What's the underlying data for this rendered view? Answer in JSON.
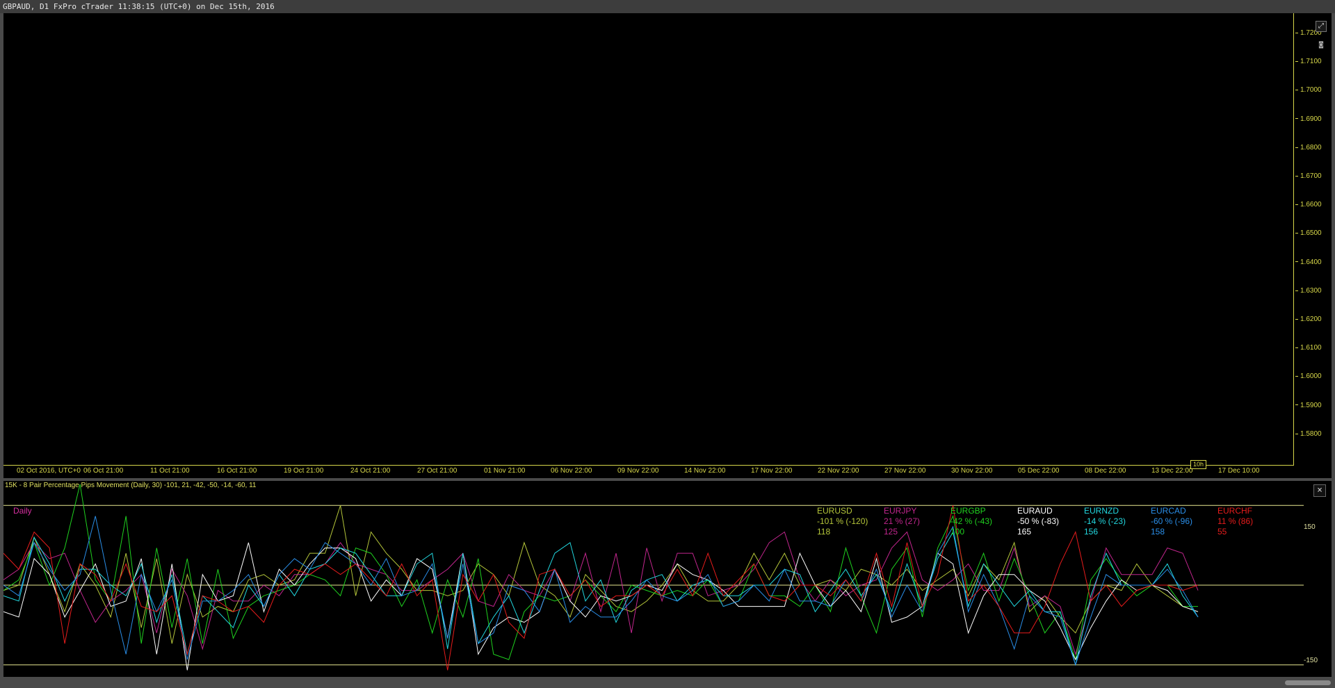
{
  "window": {
    "title": "GBPAUD, D1 FxPro cTrader 11:38:15 (UTC+0) on Dec 15th, 2016"
  },
  "main_chart": {
    "price_ticks": [
      "1.7200",
      "1.7100",
      "1.7000",
      "1.6900",
      "1.6800",
      "1.6700",
      "1.6600",
      "1.6500",
      "1.6400",
      "1.6300",
      "1.6200",
      "1.6100",
      "1.6000",
      "1.5900",
      "1.5800"
    ],
    "time_ticks": [
      "02 Oct 2016, UTC+0",
      "06 Oct 21:00",
      "11 Oct 21:00",
      "16 Oct 21:00",
      "19 Oct 21:00",
      "24 Oct 21:00",
      "27 Oct 21:00",
      "01 Nov 21:00",
      "06 Nov 22:00",
      "09 Nov 22:00",
      "14 Nov 22:00",
      "17 Nov 22:00",
      "22 Nov 22:00",
      "27 Nov 22:00",
      "30 Nov 22:00",
      "05 Dec 22:00",
      "08 Dec 22:00",
      "13 Dec 22:00",
      "17 Dec 10:00"
    ],
    "crosshair_label": "10h",
    "axis_color": "#d8d84a",
    "icons": [
      "expand-icon",
      "camera-icon"
    ]
  },
  "indicator": {
    "title": "15K - 8 Pair Percentage Pips Movement (Daily, 30) -101, 21, -42, -50, -14, -60, 11",
    "period_label": "Daily",
    "close_label": "×",
    "axis_labels": {
      "upper": "150",
      "lower": "-150"
    },
    "legend": [
      {
        "pair": "EURUSD",
        "pct": "-101 % (-120)",
        "value": "118",
        "color": "#b5c63a"
      },
      {
        "pair": "EURJPY",
        "pct": "21 % (27)",
        "value": "125",
        "color": "#c2268e"
      },
      {
        "pair": "EURGBP",
        "pct": "-42 % (-43)",
        "value": "100",
        "color": "#1fd21f"
      },
      {
        "pair": "EURAUD",
        "pct": "-50 % (-83)",
        "value": "165",
        "color": "#ffffff"
      },
      {
        "pair": "EURNZD",
        "pct": "-14 % (-23)",
        "value": "156",
        "color": "#22d8e0"
      },
      {
        "pair": "EURCAD",
        "pct": "-60 % (-96)",
        "value": "158",
        "color": "#2a8ee8"
      },
      {
        "pair": "EURCHF",
        "pct": "11 % (86)",
        "value": "55",
        "color": "#e81c1c"
      }
    ],
    "chart_data": {
      "type": "line",
      "ylim": [
        -170,
        170
      ],
      "hlines": [
        150,
        0,
        -150
      ],
      "series": [
        {
          "name": "EURUSD",
          "color": "#b5c63a",
          "values": [
            -10,
            0,
            90,
            20,
            -50,
            40,
            0,
            -60,
            60,
            -80,
            50,
            -110,
            20,
            -60,
            -40,
            -50,
            10,
            20,
            0,
            10,
            60,
            60,
            150,
            -20,
            100,
            60,
            30,
            -10,
            -10,
            -20,
            -10,
            40,
            20,
            -20,
            80,
            0,
            -20,
            -60,
            20,
            -10,
            -40,
            -50,
            -30,
            0,
            40,
            -10,
            -30,
            -30,
            0,
            60,
            10,
            60,
            0,
            0,
            10,
            -10,
            30,
            20,
            0,
            30,
            -10,
            10,
            30,
            -20,
            40,
            10,
            80,
            -50,
            -20,
            -60,
            -90,
            -30,
            0,
            -10,
            40,
            0,
            -20,
            -40,
            -50
          ]
        },
        {
          "name": "EURJPY",
          "color": "#c2268e",
          "values": [
            10,
            30,
            80,
            50,
            60,
            -10,
            -70,
            -30,
            -10,
            20,
            -90,
            30,
            -20,
            -120,
            -10,
            -30,
            -30,
            0,
            -20,
            20,
            20,
            40,
            80,
            40,
            30,
            20,
            -10,
            -10,
            10,
            30,
            60,
            -30,
            -40,
            20,
            -10,
            -20,
            30,
            -30,
            60,
            -50,
            60,
            -90,
            70,
            -30,
            60,
            60,
            -20,
            -10,
            0,
            30,
            80,
            100,
            10,
            -30,
            10,
            -20,
            0,
            10,
            70,
            100,
            10,
            -10,
            10,
            40,
            -10,
            -10,
            70,
            -40,
            -20,
            -40,
            -130,
            -30,
            70,
            20,
            20,
            20,
            70,
            60,
            -10
          ]
        },
        {
          "name": "EURGBP",
          "color": "#1fd21f",
          "values": [
            -10,
            10,
            80,
            0,
            70,
            190,
            10,
            -30,
            130,
            -110,
            70,
            -80,
            50,
            -110,
            30,
            -100,
            -40,
            -20,
            -10,
            0,
            20,
            10,
            -20,
            70,
            60,
            20,
            -40,
            10,
            -90,
            10,
            -60,
            50,
            -130,
            -140,
            -50,
            -20,
            -30,
            -20,
            10,
            -20,
            -50,
            0,
            -10,
            -20,
            -10,
            -20,
            10,
            -40,
            -30,
            40,
            -20,
            -20,
            -40,
            0,
            -50,
            70,
            -20,
            -90,
            30,
            70,
            -60,
            70,
            130,
            -10,
            60,
            -30,
            50,
            -20,
            -90,
            -50,
            -140,
            10,
            50,
            10,
            -20,
            0,
            0,
            -40,
            -40
          ]
        },
        {
          "name": "EURAUD",
          "color": "#ffffff",
          "values": [
            -50,
            -60,
            50,
            20,
            -60,
            -10,
            40,
            -40,
            -30,
            50,
            -130,
            40,
            -160,
            20,
            -30,
            -20,
            80,
            -50,
            30,
            0,
            40,
            70,
            70,
            50,
            -30,
            10,
            -20,
            50,
            30,
            -100,
            60,
            -130,
            -80,
            -60,
            -70,
            -50,
            30,
            -30,
            -60,
            -20,
            -30,
            -20,
            0,
            -10,
            40,
            20,
            10,
            -10,
            -40,
            -40,
            -40,
            -40,
            60,
            0,
            -40,
            -10,
            -50,
            50,
            -70,
            -60,
            -40,
            60,
            40,
            -90,
            -20,
            20,
            20,
            -10,
            -30,
            -80,
            -140,
            -80,
            -30,
            10,
            -10,
            0,
            -10,
            -40,
            -50
          ]
        },
        {
          "name": "EURNZD",
          "color": "#22d8e0",
          "values": [
            -20,
            -30,
            90,
            40,
            -30,
            30,
            30,
            0,
            -20,
            40,
            -70,
            20,
            -130,
            -20,
            -50,
            -80,
            0,
            -40,
            20,
            -20,
            30,
            40,
            70,
            60,
            20,
            -20,
            -20,
            40,
            60,
            -120,
            60,
            -110,
            -60,
            -20,
            -90,
            -10,
            60,
            80,
            -30,
            10,
            -70,
            -10,
            10,
            20,
            -30,
            0,
            10,
            -20,
            -20,
            0,
            0,
            30,
            20,
            -50,
            -10,
            30,
            -20,
            20,
            -50,
            40,
            -40,
            50,
            100,
            -40,
            40,
            0,
            -40,
            -10,
            -50,
            -50,
            -150,
            -20,
            60,
            0,
            0,
            0,
            40,
            -20,
            -60
          ]
        },
        {
          "name": "EURCAD",
          "color": "#2a8ee8",
          "values": [
            0,
            -20,
            80,
            30,
            -10,
            20,
            130,
            -10,
            -130,
            20,
            -50,
            10,
            -140,
            -30,
            -30,
            -10,
            20,
            -40,
            20,
            50,
            30,
            80,
            60,
            40,
            0,
            50,
            -20,
            -10,
            40,
            -100,
            40,
            -110,
            -90,
            0,
            -10,
            -50,
            30,
            -70,
            -40,
            -60,
            -60,
            -30,
            10,
            -20,
            -30,
            -10,
            20,
            -40,
            -30,
            0,
            -30,
            30,
            -30,
            -30,
            -40,
            10,
            -30,
            30,
            -60,
            0,
            -50,
            60,
            110,
            -50,
            20,
            -40,
            -120,
            -20,
            -50,
            -60,
            -150,
            -60,
            20,
            0,
            0,
            0,
            30,
            -10,
            -60
          ]
        },
        {
          "name": "EURCHF",
          "color": "#e81c1c",
          "values": [
            60,
            30,
            100,
            70,
            -110,
            40,
            20,
            -30,
            40,
            -40,
            -50,
            -20,
            -130,
            -20,
            -30,
            -50,
            -40,
            -70,
            0,
            30,
            20,
            40,
            20,
            40,
            10,
            -20,
            40,
            -20,
            10,
            -160,
            20,
            -30,
            20,
            -70,
            -100,
            20,
            30,
            -20,
            10,
            -40,
            -20,
            -20,
            0,
            -20,
            30,
            -20,
            60,
            -20,
            10,
            40,
            -20,
            -30,
            0,
            0,
            -20,
            10,
            -30,
            60,
            -40,
            80,
            -40,
            20,
            150,
            -30,
            0,
            -40,
            -90,
            -90,
            -40,
            40,
            100,
            -30,
            0,
            -40,
            -10,
            0,
            0,
            -10,
            0
          ]
        }
      ]
    }
  }
}
